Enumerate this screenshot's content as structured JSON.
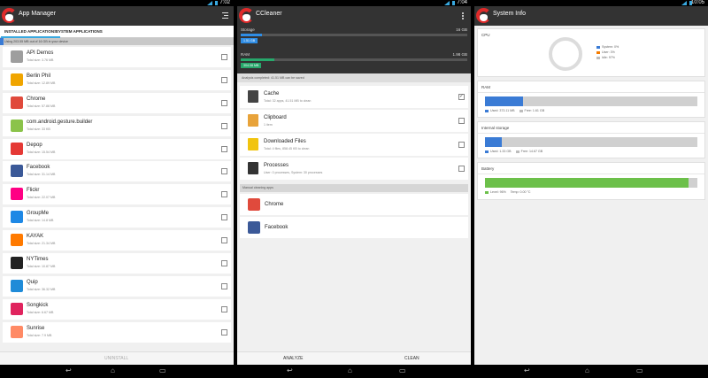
{
  "status": {
    "p1_time": "7:02",
    "p2_time": "7:04",
    "p3_time": "10:05"
  },
  "app_manager": {
    "title": "App Manager",
    "tabs": [
      "INSTALLED APPLICATIONS",
      "SYSTEM APPLICATIONS"
    ],
    "usage_text": "Using 203.55 MB out of 16 GB in your device",
    "usage_fraction": 0.016,
    "apps": [
      {
        "name": "API Demos",
        "size": "Total size: 3.76 MB",
        "icon": "api-demos-icon",
        "color": "#9e9e9e"
      },
      {
        "name": "Berlin Phil",
        "size": "Total size: 12.89 MB",
        "icon": "berlin-phil-icon",
        "color": "#f0a500"
      },
      {
        "name": "Chrome",
        "size": "Total size: 57.88 MB",
        "icon": "chrome-icon",
        "color": "#e04a3c"
      },
      {
        "name": "com.android.gesture.builder",
        "size": "Total size: 33 KB",
        "icon": "android-icon",
        "color": "#8bc34a"
      },
      {
        "name": "Depop",
        "size": "Total size: 15.54 MB",
        "icon": "depop-icon",
        "color": "#e53935"
      },
      {
        "name": "Facebook",
        "size": "Total size: 31.14 MB",
        "icon": "facebook-icon",
        "color": "#3b5998"
      },
      {
        "name": "Flickr",
        "size": "Total size: 22.07 MB",
        "icon": "flickr-icon",
        "color": "#ff0084"
      },
      {
        "name": "GroupMe",
        "size": "Total size: 14.8 MB",
        "icon": "groupme-icon",
        "color": "#1e88e5"
      },
      {
        "name": "KAYAK",
        "size": "Total size: 21.34 MB",
        "icon": "kayak-icon",
        "color": "#ff7a00"
      },
      {
        "name": "NYTimes",
        "size": "Total size: 10.87 MB",
        "icon": "nytimes-icon",
        "color": "#222222"
      },
      {
        "name": "Quip",
        "size": "Total size: 36.32 MB",
        "icon": "quip-icon",
        "color": "#1f8bd8"
      },
      {
        "name": "Songkick",
        "size": "Total size: 6.67 MB",
        "icon": "songkick-icon",
        "color": "#e0245e"
      },
      {
        "name": "Sunrise",
        "size": "Total size: 7.9 MB",
        "icon": "sunrise-icon",
        "color": "#ff8a65"
      }
    ],
    "bottom_button": "UNINSTALL"
  },
  "ccleaner": {
    "title": "CCleaner",
    "storage_label": "Storage",
    "storage_total": "16 GB",
    "storage_used": "1.51 GB",
    "storage_fraction": 0.094,
    "ram_label": "RAM",
    "ram_total": "1.98 GB",
    "ram_used": "304.08 MB",
    "ram_fraction": 0.15,
    "analysis_text": "Analysis completed: 41.51 MB can be saved",
    "items": [
      {
        "name": "Cache",
        "sub": "Total: 32 apps, 41.51 MB to clean",
        "icon": "cache-icon",
        "checked": true
      },
      {
        "name": "Clipboard",
        "sub": "1 item",
        "icon": "clipboard-icon",
        "checked": false
      },
      {
        "name": "Downloaded Files",
        "sub": "Total: 4 files, 858.45 KB to clean",
        "icon": "downloads-icon",
        "checked": false
      },
      {
        "name": "Processes",
        "sub": "User: 0 processes, System: 30 processes",
        "icon": "processes-icon",
        "checked": false
      }
    ],
    "manual_header": "Manual cleaning apps",
    "manual_apps": [
      {
        "name": "Chrome",
        "icon": "chrome-icon"
      },
      {
        "name": "Facebook",
        "icon": "facebook-icon"
      }
    ],
    "analyze_button": "ANALYZE",
    "clean_button": "CLEAN"
  },
  "system_info": {
    "title": "System Info",
    "cpu_label": "CPU",
    "cpu_legend": [
      "System: 0%",
      "User: 3%",
      "Idle: 97%"
    ],
    "cpu_colors": [
      "#3a7bd5",
      "#f57c00",
      "#bdbdbd"
    ],
    "ram_label": "RAM",
    "ram_used": "Used: 373.11 MB",
    "ram_free": "Free: 1.61 GB",
    "ram_fraction": 0.18,
    "internal_label": "Internal storage",
    "internal_used": "Used: 1.33 GB",
    "internal_free": "Free: 14.67 GB",
    "internal_fraction": 0.08,
    "battery_label": "Battery",
    "battery_level": "Level: 96%",
    "battery_temp": "Temp: 0.00 °C",
    "battery_fraction": 0.96
  },
  "colors": {
    "accent_blue": "#3a7bd5",
    "ram_green": "#27a86b",
    "battery_green": "#6cc04a",
    "storage_blue": "#2f8de4"
  },
  "navbar": [
    "back-icon",
    "home-icon",
    "recents-icon"
  ]
}
